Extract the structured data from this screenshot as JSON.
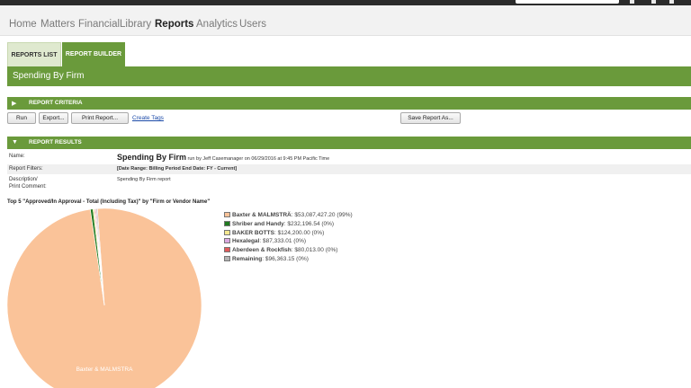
{
  "nav": {
    "items": [
      "Home",
      "Matters",
      "Financial",
      "Library",
      "Reports",
      "Analytics",
      "Users"
    ],
    "active": "Reports"
  },
  "subtabs": {
    "reports_list": "REPORTS LIST",
    "report_builder": "REPORT BUILDER"
  },
  "page_title": "Spending By Firm",
  "criteria": {
    "header": "REPORT CRITERIA",
    "buttons": {
      "run": "Run",
      "export": "Export...",
      "print": "Print Report...",
      "save": "Save Report As..."
    },
    "create_tags": "Create Tags"
  },
  "results": {
    "header": "REPORT RESULTS",
    "name_label": "Name:",
    "name_value": "Spending By Firm",
    "run_by": "run by Jeff Casemanager on 06/29/2016 at 9:45 PM Pacific Time",
    "filters_label": "Report Filters:",
    "filters_value": "[Date Range: Billing Period End Date: FY - Current]",
    "description_label": "Description/",
    "print_comment_label": "Print Comment:",
    "description_value": "Spending By Firm report"
  },
  "chart_data": {
    "type": "pie",
    "title": "Top 5 \"Approved/In Approval - Total (Including Tax)\" by \"Firm or Vendor Name\"",
    "slices": [
      {
        "name": "Baxter & MALMSTRÄ",
        "value": 53087427.2,
        "label": "$53,087,427.20 (99%)",
        "color": "#fac399"
      },
      {
        "name": "Shriber and Handy",
        "value": 232196.54,
        "label": "$232,196.54 (0%)",
        "color": "#1f7a1f"
      },
      {
        "name": "BAKER BOTTS",
        "value": 124200.0,
        "label": "$124,200.00 (0%)",
        "color": "#f5e88f"
      },
      {
        "name": "Hexalegal",
        "value": 87333.01,
        "label": "$87,333.01 (0%)",
        "color": "#d9a8e0"
      },
      {
        "name": "Aberdeen & Rockfish",
        "value": 80013.0,
        "label": "$80,013.00 (0%)",
        "color": "#e05a5a"
      },
      {
        "name": "Remaining",
        "value": 96363.15,
        "label": "$96,363.15 (0%)",
        "color": "#b3b3b3"
      }
    ],
    "slice_label": "Baxter & MALMSTRA"
  }
}
